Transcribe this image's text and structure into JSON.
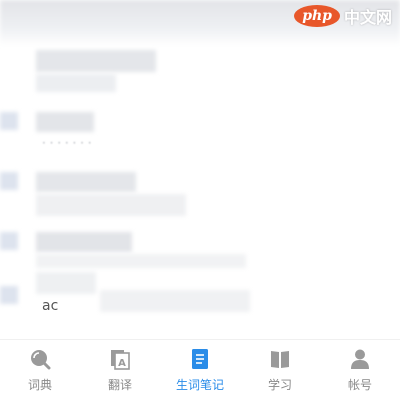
{
  "watermark": {
    "logo": "php",
    "text": "中文网"
  },
  "content": {
    "faint_text": "· · · · ·  · ·",
    "visible_word": "ac"
  },
  "tabbar": {
    "items": [
      {
        "label": "词典",
        "icon": "magnifier-icon",
        "active": false
      },
      {
        "label": "翻译",
        "icon": "translate-icon",
        "active": false
      },
      {
        "label": "生词笔记",
        "icon": "notebook-icon",
        "active": true
      },
      {
        "label": "学习",
        "icon": "book-icon",
        "active": false
      },
      {
        "label": "帐号",
        "icon": "user-icon",
        "active": false
      }
    ]
  },
  "colors": {
    "active": "#2a8ce8",
    "inactive_icon": "#9a9a9a",
    "inactive_label": "#888888"
  }
}
